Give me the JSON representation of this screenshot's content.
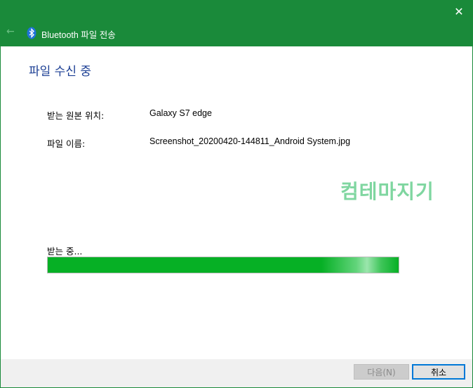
{
  "titlebar": {
    "title": "Bluetooth 파일 전송",
    "close_glyph": "✕",
    "back_glyph": "←",
    "icons": [
      "close-icon",
      "back-arrow-icon",
      "bluetooth-icon"
    ]
  },
  "main": {
    "heading": "파일 수신 중",
    "source_label": "받는 원본 위치:",
    "source_value": "Galaxy S7 edge",
    "filename_label": "파일 이름:",
    "filename_value": "Screenshot_20200420-144811_Android System.jpg",
    "watermark": "컴테마지기",
    "status_text": "받는 중...",
    "progress_fraction": 1.0
  },
  "footer": {
    "next_label": "다음(N)",
    "cancel_label": "취소"
  },
  "colors": {
    "titlebar": "#1a8a3a",
    "heading": "#1c3f94",
    "progress": "#06b025",
    "watermark": "#7fd6a0"
  }
}
